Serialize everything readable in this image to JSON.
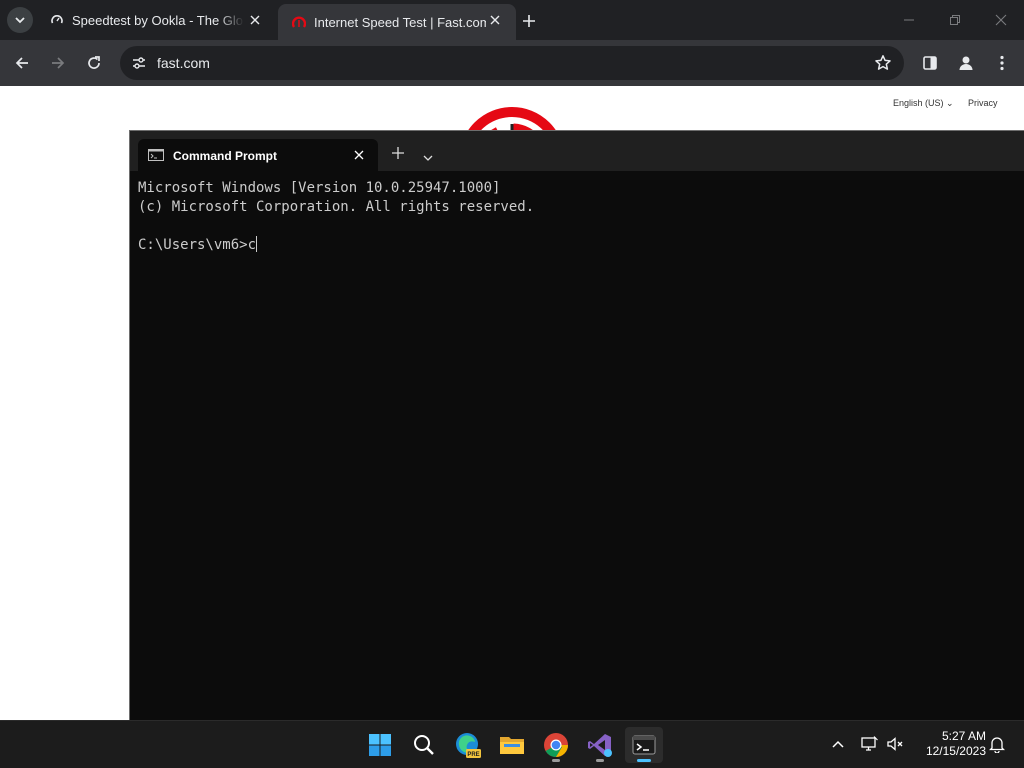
{
  "browser": {
    "tabs": [
      {
        "title": "Speedtest by Ookla - The Global Broadband Speed Test",
        "active": false
      },
      {
        "title": "Internet Speed Test | Fast.com",
        "active": true
      }
    ],
    "address_bar": {
      "url": "fast.com"
    },
    "icons": [
      "chevron-down-icon",
      "speedtest-favicon",
      "fast-favicon",
      "close-icon",
      "plus-icon",
      "minimize-icon",
      "restore-icon",
      "back-icon",
      "forward-icon",
      "reload-icon",
      "site-info-icon",
      "star-icon",
      "side-panel-icon",
      "profile-icon",
      "menu-icon"
    ]
  },
  "webpage": {
    "language": "English (US)",
    "privacy": "Privacy",
    "accent_color": "#e50914"
  },
  "terminal": {
    "tab_title": "Command Prompt",
    "lines": [
      "Microsoft Windows [Version 10.0.25947.1000]",
      "(c) Microsoft Corporation. All rights reserved.",
      "",
      "C:\\Users\\vm6>c"
    ]
  },
  "taskbar": {
    "apps": [
      "windows-start",
      "search",
      "edge-preview",
      "file-explorer",
      "chrome",
      "visual-studio",
      "terminal"
    ],
    "edge_badge": "PRE",
    "clock": {
      "time": "5:27 AM",
      "date": "12/15/2023"
    }
  },
  "colors": {
    "chrome_dark": "#202124",
    "chrome_toolbar": "#35363a",
    "terminal_bg": "#0c0c0c",
    "taskbar_bg": "#1c1c1c",
    "accent_blue": "#4cc2ff"
  }
}
